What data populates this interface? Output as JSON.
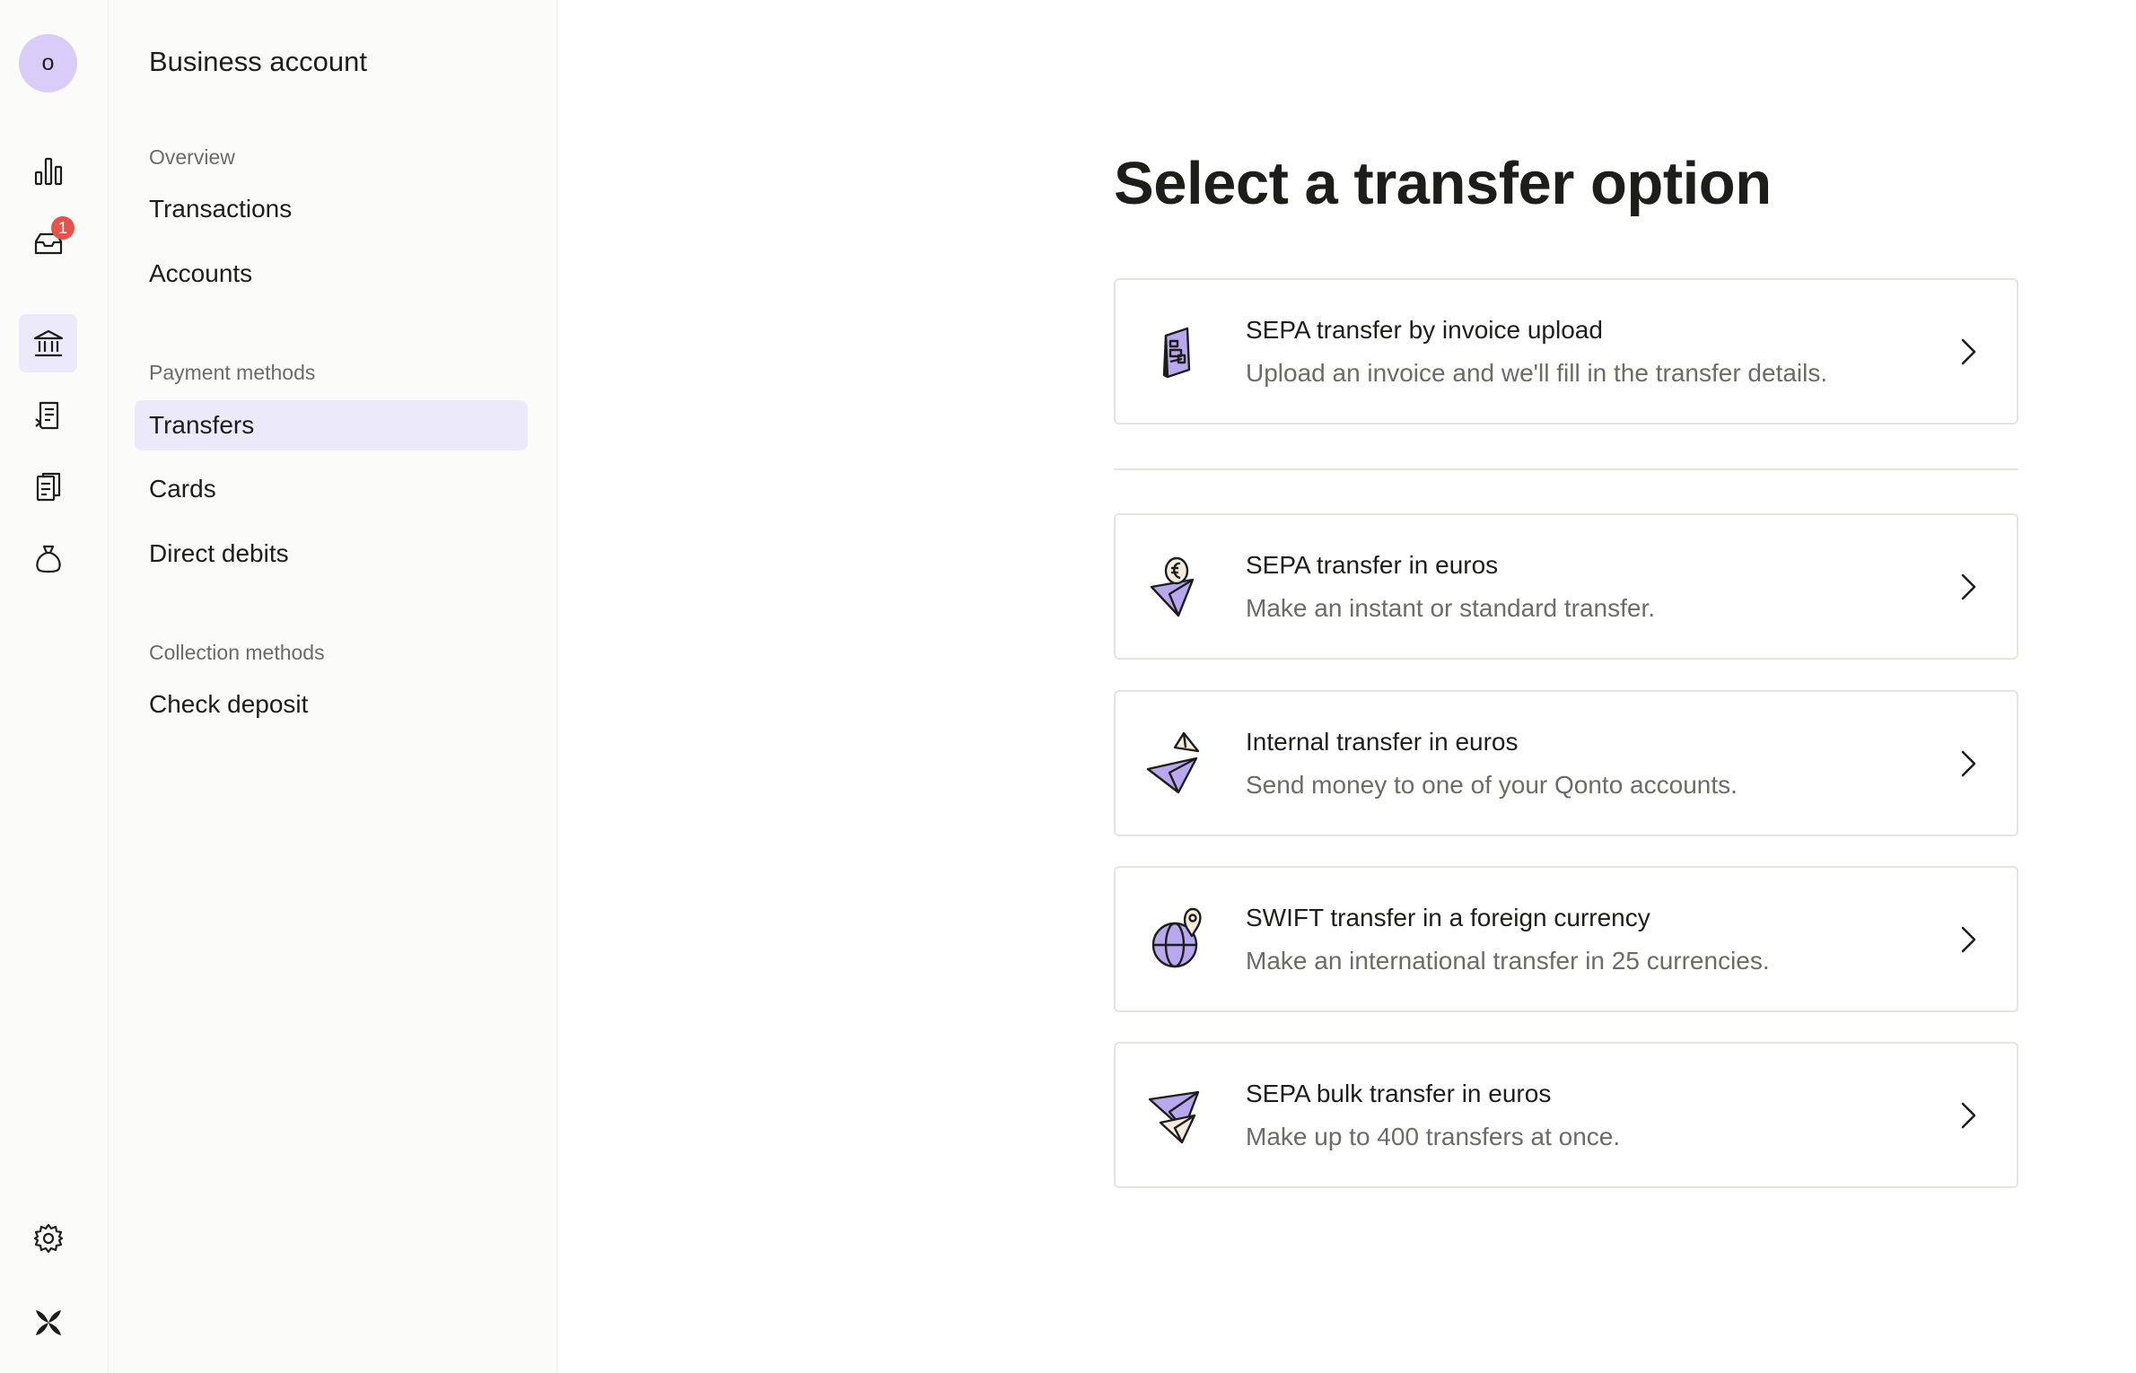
{
  "rail": {
    "avatar_letter": "o",
    "inbox_badge": "1",
    "items": [
      {
        "icon": "bar-chart-icon"
      },
      {
        "icon": "inbox-icon"
      },
      {
        "icon": "bank-icon"
      },
      {
        "icon": "invoice-icon"
      },
      {
        "icon": "documents-icon"
      },
      {
        "icon": "money-bag-icon"
      },
      {
        "icon": "gear-icon"
      },
      {
        "icon": "qonto-logo-icon"
      }
    ]
  },
  "subnav": {
    "title": "Business account",
    "overview_label": "Overview",
    "transactions": "Transactions",
    "accounts": "Accounts",
    "payment_methods_label": "Payment methods",
    "transfers": "Transfers",
    "cards": "Cards",
    "direct_debits": "Direct debits",
    "collection_methods_label": "Collection methods",
    "check_deposit": "Check deposit"
  },
  "main": {
    "title": "Select a transfer option",
    "options": [
      {
        "title": "SEPA transfer by invoice upload",
        "desc": "Upload an invoice and we'll fill in the transfer details.",
        "icon": "invoice-upload-icon"
      },
      {
        "title": "SEPA transfer in euros",
        "desc": "Make an instant or standard transfer.",
        "icon": "euro-paper-plane-icon"
      },
      {
        "title": "Internal transfer in euros",
        "desc": "Send money to one of your Qonto accounts.",
        "icon": "internal-paper-plane-icon"
      },
      {
        "title": "SWIFT transfer in a foreign currency",
        "desc": "Make an international transfer in 25 currencies.",
        "icon": "globe-pin-icon"
      },
      {
        "title": "SEPA bulk transfer in euros",
        "desc": "Make up to 400 transfers at once.",
        "icon": "bulk-paper-plane-icon"
      }
    ]
  },
  "colors": {
    "accent_lavender": "#ece9fb",
    "avatar_bg": "#d8ccf9",
    "badge_red": "#e5534b",
    "illustration_purple": "#b7a8f0"
  }
}
